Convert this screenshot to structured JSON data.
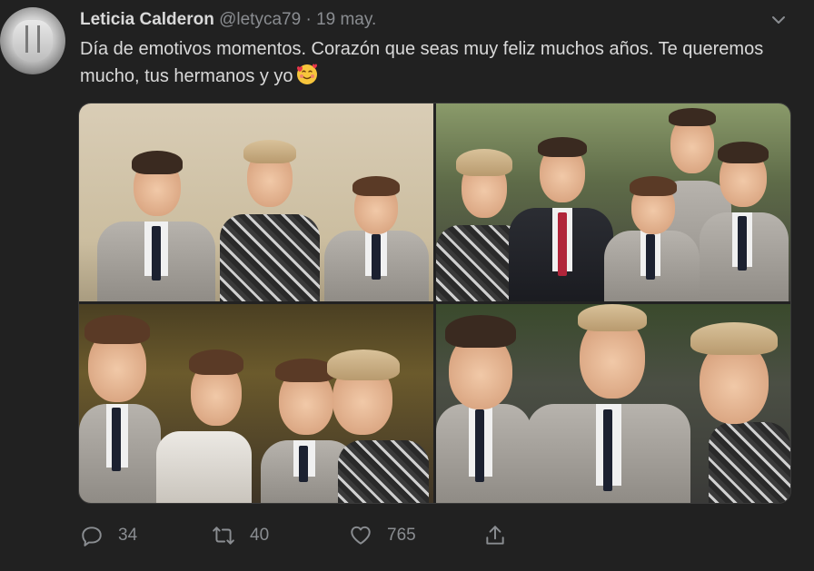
{
  "tweet": {
    "author_name": "Leticia Calderon",
    "handle": "@letyca79",
    "separator": "·",
    "date": "19 may.",
    "text": "Día de emotivos momentos. Corazón que seas muy feliz muchos años. Te queremos mucho, tus hermanos y yo",
    "emoji": "smiling-face-with-hearts"
  },
  "media": {
    "photo_count": 4
  },
  "actions": {
    "replies": "34",
    "retweets": "40",
    "likes": "765"
  },
  "icons": {
    "avatar": "avatar-photo",
    "menu": "chevron-down-icon",
    "reply": "reply-icon",
    "retweet": "retweet-icon",
    "like": "heart-icon",
    "share": "share-icon"
  },
  "colors": {
    "background": "#212121",
    "text": "#d9d9d9",
    "muted": "#8a8d91"
  }
}
